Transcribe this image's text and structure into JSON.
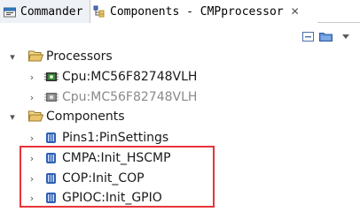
{
  "tabs": [
    {
      "label": "Commander"
    },
    {
      "label": "Components - CMPprocessor",
      "close": "✕"
    }
  ],
  "toolbar": {
    "collapse_icon": "collapse-all-icon",
    "folder_icon": "open-folder-icon",
    "view_menu_icon": "view-menu-icon"
  },
  "tree": {
    "processors": {
      "label": "Processors",
      "expanded": true,
      "children": [
        {
          "label": "Cpu:MC56F82748VLH",
          "enabled": true
        },
        {
          "label": "Cpu:MC56F82748VLH",
          "enabled": false
        }
      ]
    },
    "components": {
      "label": "Components",
      "expanded": true,
      "children": [
        {
          "label": "Pins1:PinSettings"
        },
        {
          "label": "CMPA:Init_HSCMP"
        },
        {
          "label": "COP:Init_COP"
        },
        {
          "label": "GPIOC:Init_GPIO"
        }
      ]
    }
  },
  "colors": {
    "highlight_box": "#e8343a",
    "folder": "#e9c46a",
    "bean": "#2f5fb3"
  }
}
